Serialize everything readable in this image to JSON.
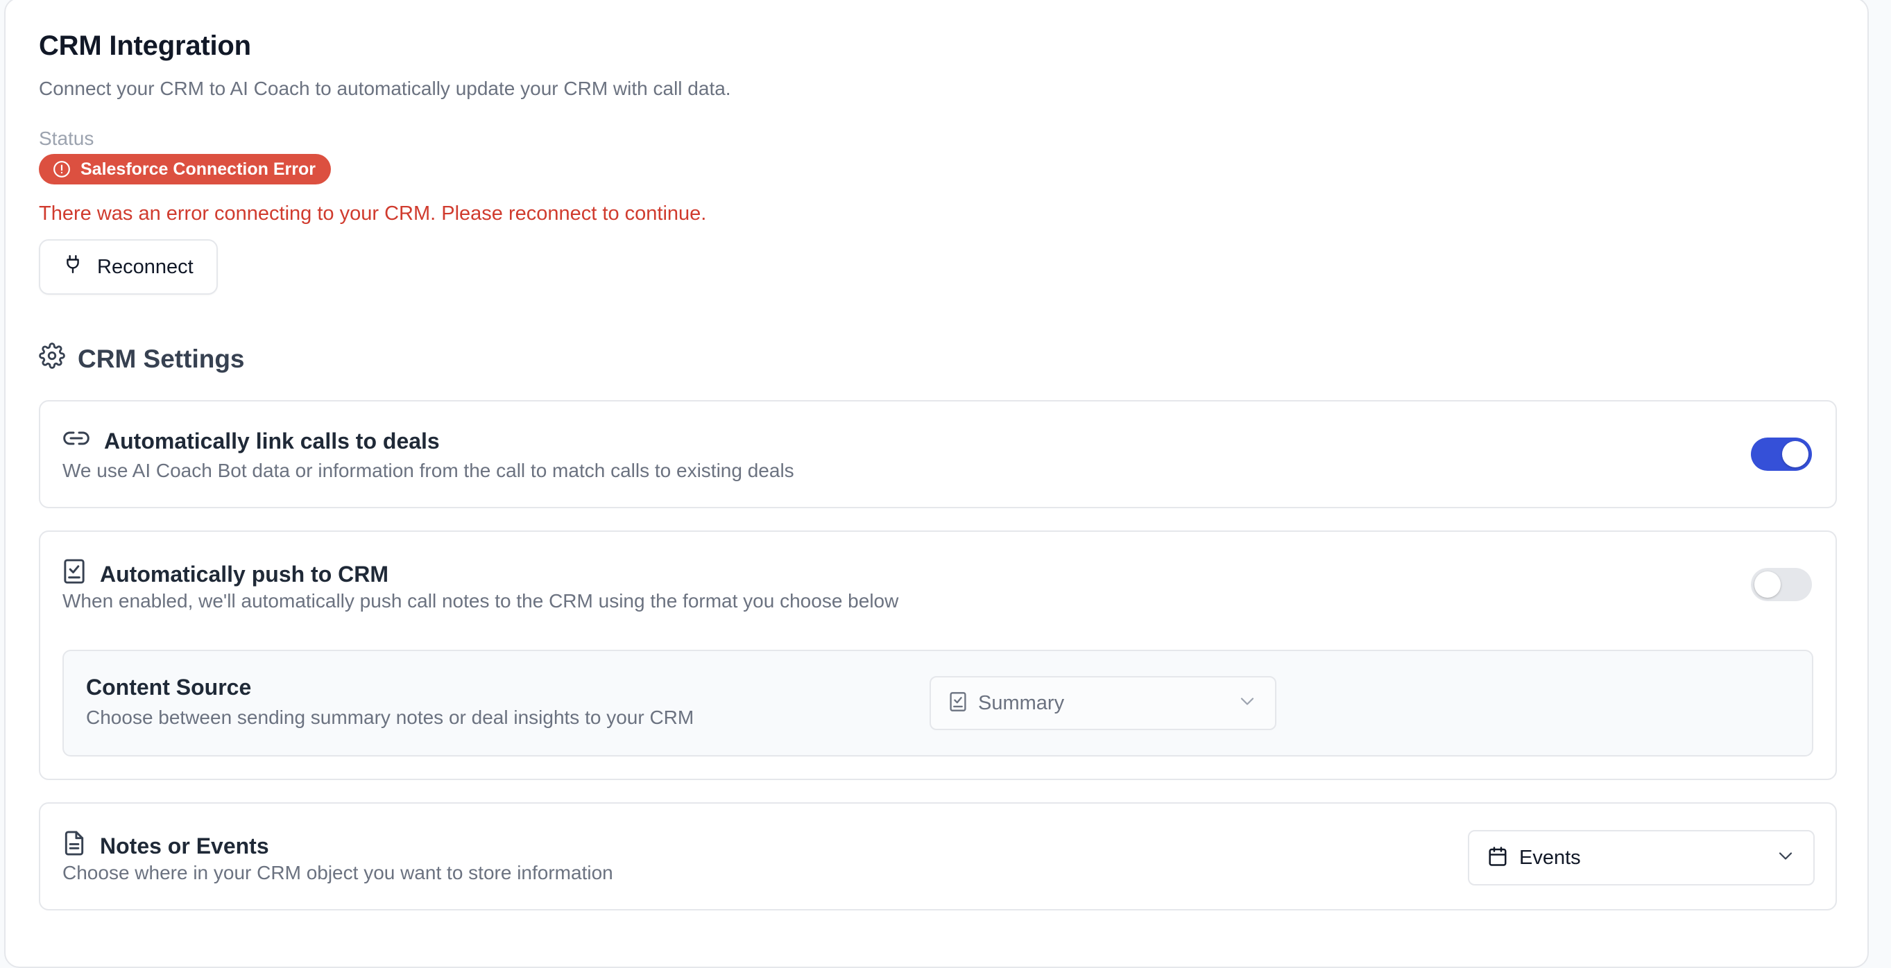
{
  "header": {
    "title": "CRM Integration",
    "subtitle": "Connect your CRM to AI Coach to automatically update your CRM with call data."
  },
  "status": {
    "label": "Status",
    "badge_text": "Salesforce Connection Error",
    "badge_icon": "alert-circle-icon",
    "badge_color": "#dc5040",
    "error_message": "There was an error connecting to your CRM. Please reconnect to continue.",
    "error_color": "#d03b2e",
    "reconnect_label": "Reconnect",
    "reconnect_icon": "plug-icon"
  },
  "settings": {
    "heading": "CRM Settings",
    "heading_icon": "gear-icon",
    "link_calls": {
      "title": "Automatically link calls to deals",
      "description": "We use AI Coach Bot data or information from the call to match calls to existing deals",
      "icon": "link-icon",
      "enabled": true
    },
    "push_crm": {
      "title": "Automatically push to CRM",
      "description": "When enabled, we'll automatically push call notes to the CRM using the format you choose below",
      "icon": "clipboard-check-icon",
      "enabled": false,
      "content_source": {
        "title": "Content Source",
        "description": "Choose between sending summary notes or deal insights to your CRM",
        "selected": "Summary",
        "selected_icon": "clipboard-check-icon",
        "disabled": true
      }
    },
    "notes_events": {
      "title": "Notes or Events",
      "description": "Choose where in your CRM object you want to store information",
      "icon": "file-text-icon",
      "selected": "Events",
      "selected_icon": "calendar-icon"
    }
  },
  "colors": {
    "accent": "#3550d8",
    "toggle_off": "#e5e7eb"
  }
}
